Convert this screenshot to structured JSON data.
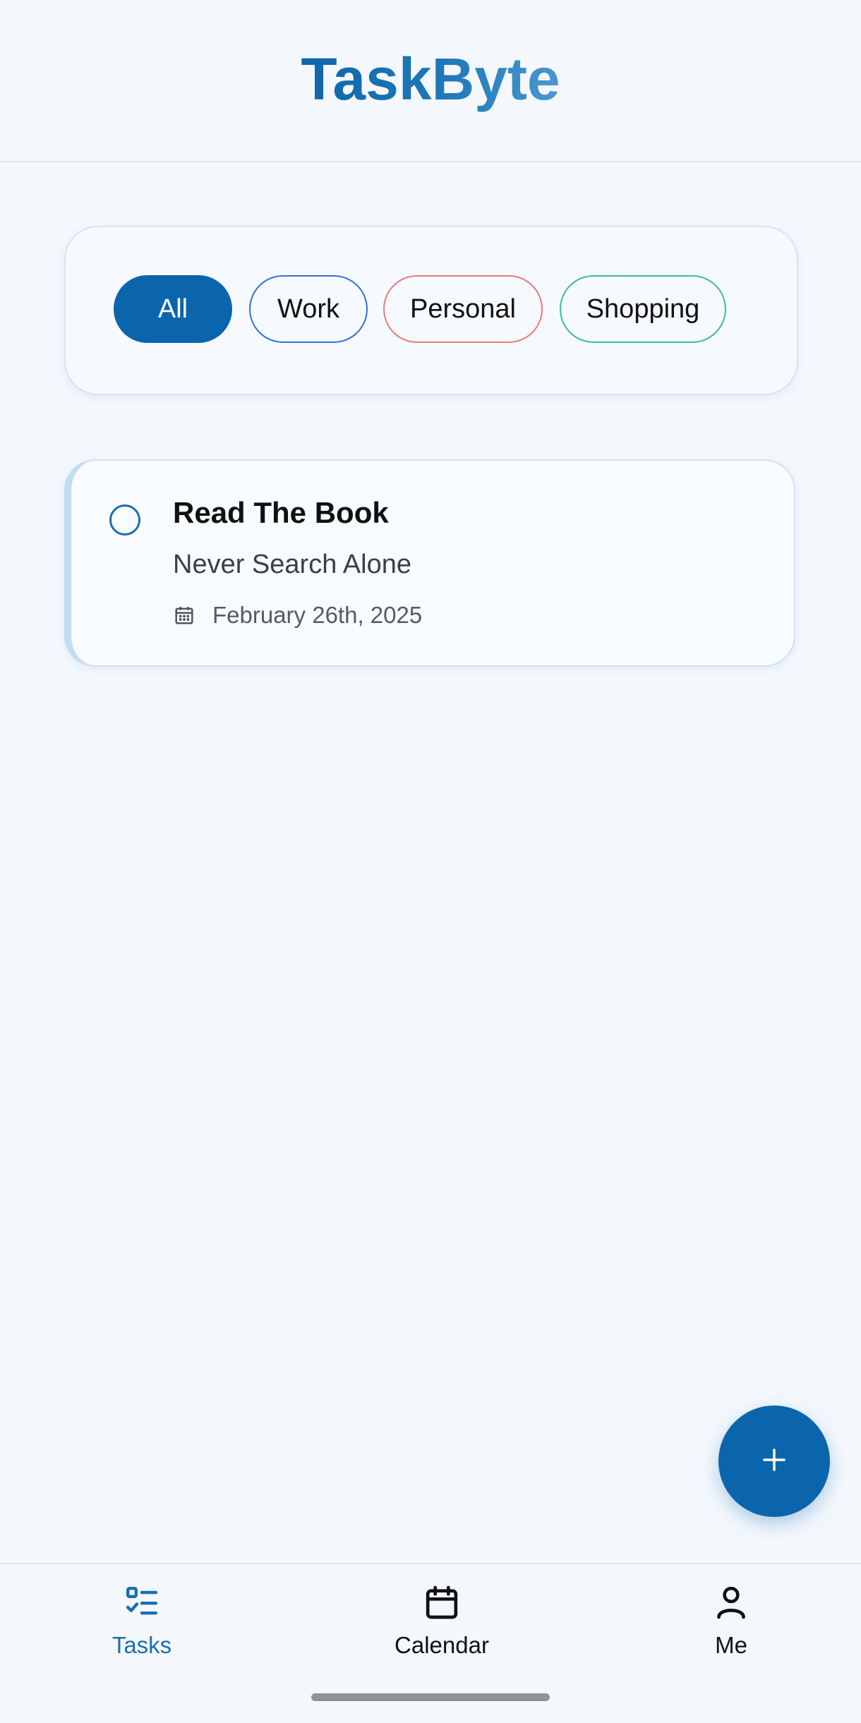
{
  "app": {
    "title": "TaskByte"
  },
  "filters": {
    "chips": [
      {
        "label": "All",
        "selected": true,
        "color": "#0b65ac"
      },
      {
        "label": "Work",
        "selected": false,
        "color": "#3273d4"
      },
      {
        "label": "Personal",
        "selected": false,
        "color": "#ea7b7b"
      },
      {
        "label": "Shopping",
        "selected": false,
        "color": "#3bbf94"
      }
    ]
  },
  "tasks": [
    {
      "title": "Read The Book",
      "description": "Never Search Alone",
      "date": "February 26th, 2025",
      "date_icon": "calendar-icon",
      "completed": false
    }
  ],
  "fab": {
    "icon": "plus-icon"
  },
  "bottom_nav": {
    "items": [
      {
        "label": "Tasks",
        "icon": "task-list-icon",
        "active": true
      },
      {
        "label": "Calendar",
        "icon": "calendar-icon",
        "active": false
      },
      {
        "label": "Me",
        "icon": "person-icon",
        "active": false
      }
    ]
  },
  "colors": {
    "brand": "#0b65ac",
    "background": "#f4f8fd",
    "active_nav": "#1a6fb0"
  }
}
